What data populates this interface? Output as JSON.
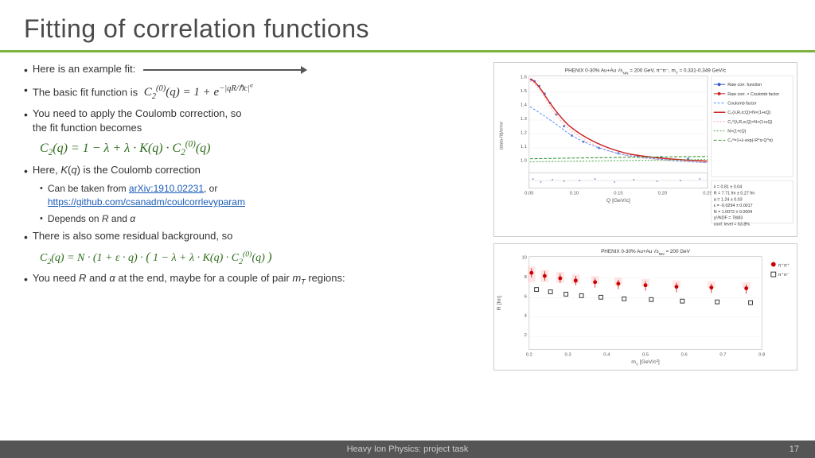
{
  "slide": {
    "title": "Fitting of correlation functions",
    "footer_text": "Heavy Ion Physics: project task",
    "page_number": "17"
  },
  "content": {
    "bullets": [
      {
        "id": "b1",
        "text": "Here is an example fit:"
      },
      {
        "id": "b2",
        "text_prefix": "The basic fit function is",
        "formula": "C₂⁽⁰⁾(q) = 1 + e^(−|qR/ℏc|^α)"
      },
      {
        "id": "b3",
        "text": "You need to apply the Coulomb correction, so the fit function becomes",
        "formula": "C₂(q) = 1 − λ + λ · K(q) · C₂⁽⁰⁾(q)"
      },
      {
        "id": "b4",
        "text_prefix": "Here, K(q) is the Coulomb correction",
        "sub_bullets": [
          {
            "text_prefix": "Can be taken from",
            "link1": "arXiv:1910.02231",
            "text_middle": ", or",
            "link2": "https://github.com/csanadm/coulcorrlevyparam"
          },
          {
            "text": "Depends on R and α"
          }
        ]
      },
      {
        "id": "b5",
        "text": "There is also some residual background, so",
        "formula": "C₂(q) = N · (1 + ε · q) · (1 − λ + λ · K(q) · C₂⁽⁰⁾(q))"
      },
      {
        "id": "b6",
        "text_prefix": "You need R and α at the end, maybe for a couple of pair m_T regions:"
      }
    ]
  },
  "charts": {
    "top": {
      "title": "PHENIX 0-30% Au+Au √s_NN = 200 GeV, π⁺π⁻, m_T = 0.331-0.349 GeV/c",
      "y_label": "(data-fit)/error",
      "x_label": "Q [GeV/c]",
      "legend": [
        "Raw corr. function",
        "Raw corr. × Coulomb factor",
        "Coulomb factor",
        "C₂(λ,R,α;Q) × N × (1+εQ)",
        "C₂⁰(λ,R,α;Q) × N × (1+εQ)",
        "N × (1+εQ)",
        "C₂⁰=1+λ· exp(-R^α · Q^α)"
      ],
      "params": {
        "lambda": "0.81 ± 0.04",
        "R": "7.71 fm ± 0.27 fm",
        "alpha": "1.24 ± 0.03",
        "epsilon": "-0.0294 ± 0.0017",
        "N": "1.0072 ± 0.0004",
        "chi2_ndf": "78/83",
        "conf_level": "63.8%"
      }
    },
    "bottom": {
      "title": "PHENIX 0-30% Au+Au √s_NN = 200 GeV",
      "y_label": "R [fm]",
      "x_label": "m_T [GeV/c²]",
      "series": [
        "π⁺π⁺",
        "π⁺π⁻"
      ]
    }
  }
}
